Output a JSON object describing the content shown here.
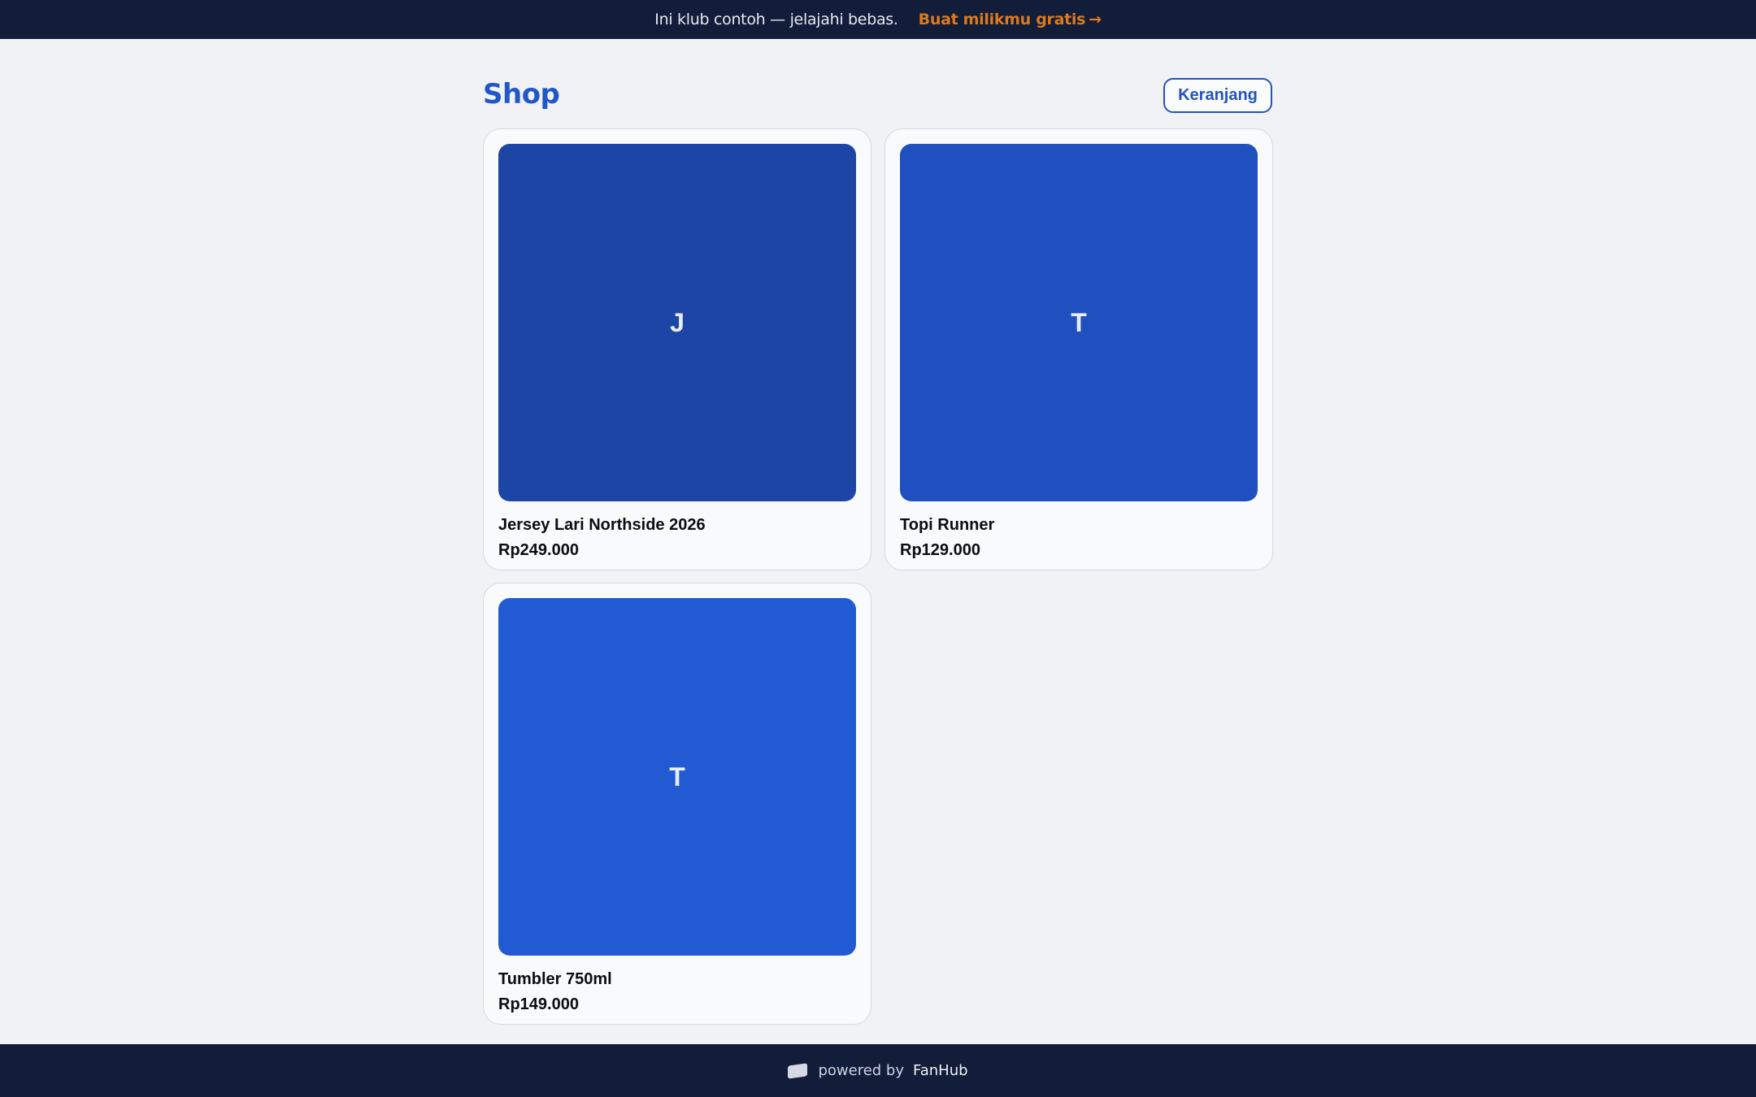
{
  "banner": {
    "message": "Ini klub contoh — jelajahi bebas.",
    "cta_label": "Buat milikmu gratis",
    "cta_arrow": "→"
  },
  "header": {
    "title": "Shop",
    "cart_label": "Keranjang"
  },
  "products": [
    {
      "initial": "J",
      "name": "Jersey Lari Northside 2026",
      "price": "Rp249.000",
      "color": "#1c45a5"
    },
    {
      "initial": "T",
      "name": "Topi Runner",
      "price": "Rp129.000",
      "color": "#2050bf"
    },
    {
      "initial": "T",
      "name": "Tumbler 750ml",
      "price": "Rp149.000",
      "color": "#225ad4"
    }
  ],
  "footer": {
    "powered_by": "powered by",
    "brand": "FanHub",
    "logo_icon": "fanhub-logo-icon"
  },
  "colors": {
    "banner_bg": "#111d39",
    "accent": "#2257c9",
    "cta": "#dd7a1d",
    "page_bg": "#f1f2f6"
  }
}
